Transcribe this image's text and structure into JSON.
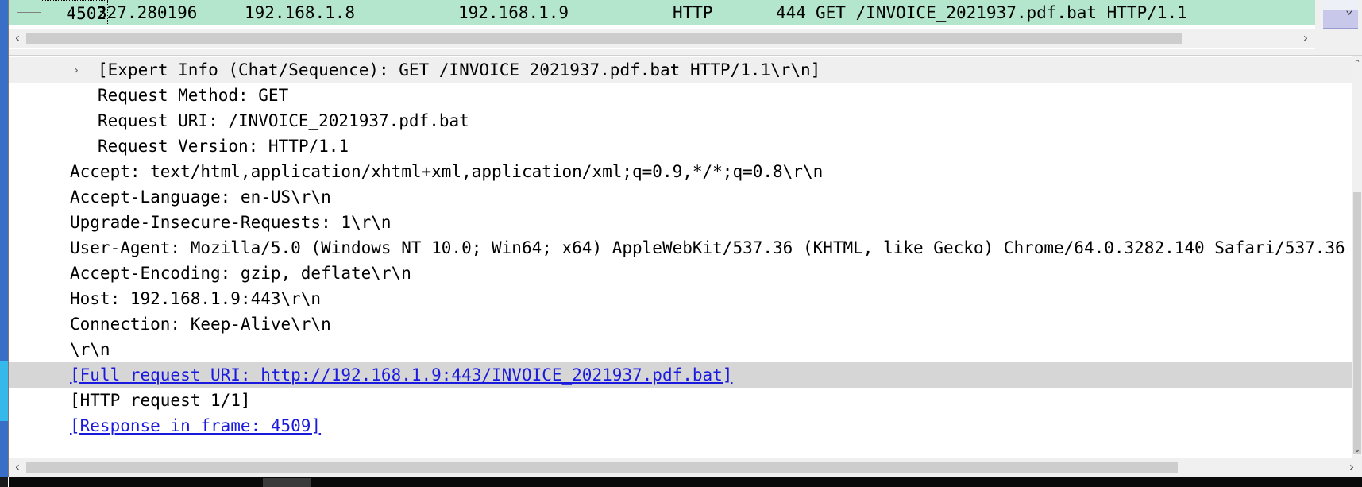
{
  "packet_list": {
    "selected_packet": {
      "no": "4502",
      "time": "327.280196",
      "source": "192.168.1.8",
      "destination": "192.168.1.9",
      "protocol": "HTTP",
      "length": "444",
      "info": "GET /INVOICE_2021937.pdf.bat HTTP/1.1"
    },
    "row_color": "#b3e6cc"
  },
  "details": {
    "expert_info": "[Expert Info (Chat/Sequence): GET /INVOICE_2021937.pdf.bat HTTP/1.1\\r\\n]",
    "request_method": "Request Method: GET",
    "request_uri": "Request URI: /INVOICE_2021937.pdf.bat",
    "request_version": "Request Version: HTTP/1.1",
    "accept": "Accept: text/html,application/xhtml+xml,application/xml;q=0.9,*/*;q=0.8\\r\\n",
    "accept_language": "Accept-Language: en-US\\r\\n",
    "upgrade_insecure": "Upgrade-Insecure-Requests: 1\\r\\n",
    "user_agent": "User-Agent: Mozilla/5.0 (Windows NT 10.0; Win64; x64) AppleWebKit/537.36 (KHTML, like Gecko) Chrome/64.0.3282.140 Safari/537.36",
    "accept_encoding": "Accept-Encoding: gzip, deflate\\r\\n",
    "host": "Host: 192.168.1.9:443\\r\\n",
    "connection": "Connection: Keep-Alive\\r\\n",
    "crlf": "\\r\\n",
    "full_request_uri": "[Full request URI: http://192.168.1.9:443/INVOICE_2021937.pdf.bat]",
    "http_request": "[HTTP request 1/1]",
    "response_in_frame": "[Response in frame: 4509]"
  },
  "icons": {
    "expand": "chevron-right-icon",
    "scroll_left": "arrow-left-icon",
    "scroll_right": "arrow-right-icon"
  },
  "colors": {
    "link": "#1a1adf",
    "selected_line": "#d6d6d6"
  }
}
